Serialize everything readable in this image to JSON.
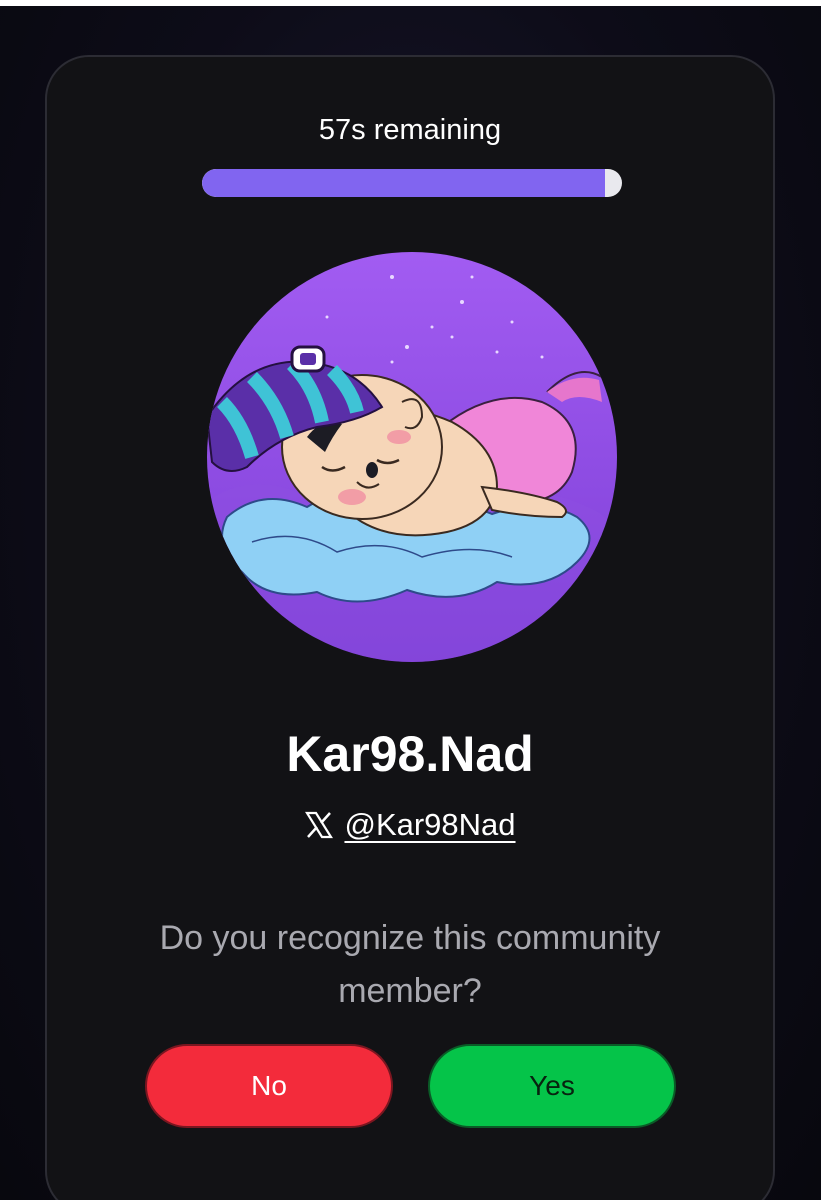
{
  "timer": {
    "text": "57s remaining",
    "progress_fraction": 0.96
  },
  "profile": {
    "avatar_description_icon": "sleeping-baby-avatar",
    "name": "Kar98.Nad",
    "x_handle": "@Kar98Nad"
  },
  "prompt": {
    "question": "Do you recognize this community member?"
  },
  "actions": {
    "no_label": "No",
    "yes_label": "Yes"
  },
  "colors": {
    "progress": "#8165f0",
    "no_button": "#f32b3b",
    "yes_button": "#05c449",
    "card_bg": "#121215"
  }
}
